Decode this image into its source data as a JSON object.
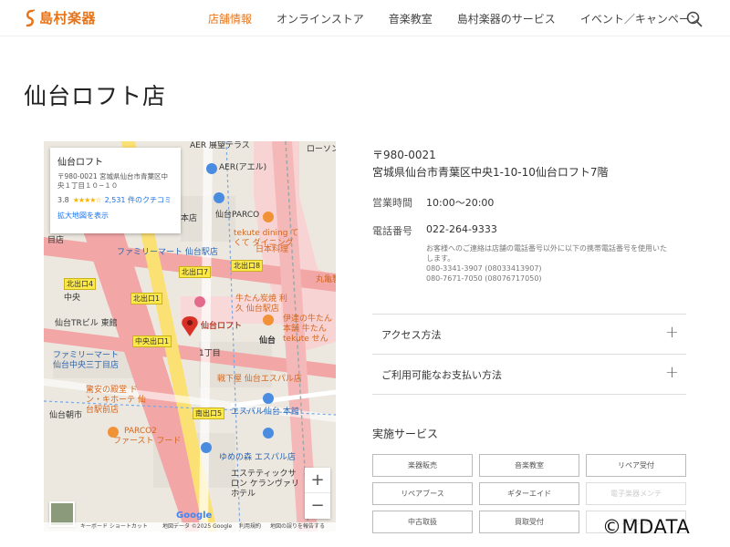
{
  "header": {
    "logo_text": "島村楽器",
    "nav": [
      "店舗情報",
      "オンラインストア",
      "音楽教室",
      "島村楽器のサービス",
      "イベント／キャンペーン"
    ],
    "active_nav": 0,
    "search_icon": "search-icon"
  },
  "page_title": "仙台ロフト店",
  "map": {
    "info_card": {
      "title": "仙台ロフト",
      "address": "〒980-0021 宮城県仙台市青葉区中央１丁目１０−１０",
      "rating": "3.8",
      "stars": "★★★★☆",
      "reviews": "2,531 件のクチコミ",
      "link": "拡大地図を表示"
    },
    "labels": {
      "aer_terrace": "AER 展望テラス",
      "lawson": "ローソン",
      "aer": "AER(アエル)",
      "sendai_parco": "仙台PARCO",
      "tekute_dining": "tekute dining てくて ダイニング",
      "nihon_ryori": "日本料理",
      "family_mart_station": "ファミリーマート 仙台駅店",
      "marumitsu": "丸亀製",
      "chuo": "中央",
      "gyutan": "牛たん炭焼 利久 仙台駅店",
      "date_gyutan": "伊達の牛たん本舗 牛たん tekute せん",
      "sendai_tr": "仙台TRビル 東館",
      "loft_pin": "仙台ロフト",
      "sendai_station": "仙台",
      "family_mart_chuo": "ファミリーマート 仙台中央三丁目店",
      "icchome": "1丁目",
      "sendai_asa": "仙台朝市",
      "donki": "驚安の殿堂 ドン・キホーテ 仙台駅前店",
      "kura": "戦下屋 仙台エスパル店",
      "parco2": "PARCO2",
      "fast_food": "ファースト フード",
      "s_pal": "エスパル仙台 本館",
      "yumenomachi": "ゆめの森 エスパル店",
      "esthe": "エステティックサロン ケランヴァリ ホテル",
      "honten": "本店",
      "mokume": "目店"
    },
    "exits": [
      "北出口8",
      "北出口7",
      "北出口4",
      "北出口1",
      "中央出口1",
      "南出口5"
    ],
    "zoom_in": "+",
    "zoom_out": "−",
    "google": "Google",
    "footer": {
      "shortcuts": "キーボード ショートカット",
      "map_data": "地図データ ©2025 Google",
      "terms": "利用規約",
      "report": "地図の誤りを報告する"
    }
  },
  "info": {
    "postal": "〒980-0021",
    "address": "宮城県仙台市青葉区中央1-10-10仙台ロフト7階",
    "hours_label": "営業時間",
    "hours": "10:00〜20:00",
    "phone_label": "電話番号",
    "phone": "022-264-9333",
    "note_lines": [
      "お客様へのご連絡は店舗の電話番号以外に以下の携帯電話番号を使用いた",
      "します。",
      "080-3341-3907 (08033413907)",
      "080-7671-7050 (08076717050)"
    ],
    "accordions": [
      "アクセス方法",
      "ご利用可能なお支払い方法"
    ],
    "services_heading": "実施サービス",
    "services": [
      "楽器販売",
      "音楽教室",
      "リペア受付",
      "リペアブース",
      "ギターエイド",
      "電子楽器メンテ",
      "中古取扱",
      "買取受付",
      "スタジオ"
    ],
    "services_faded": [
      false,
      false,
      false,
      false,
      false,
      true,
      false,
      false,
      true
    ]
  },
  "watermark": "©MDATA",
  "colors": {
    "accent": "#e8741a",
    "link": "#1a73e8",
    "map_bg": "#f2efe9",
    "pink_road": "#f3a6a6",
    "yellow_road": "#fbe173"
  }
}
